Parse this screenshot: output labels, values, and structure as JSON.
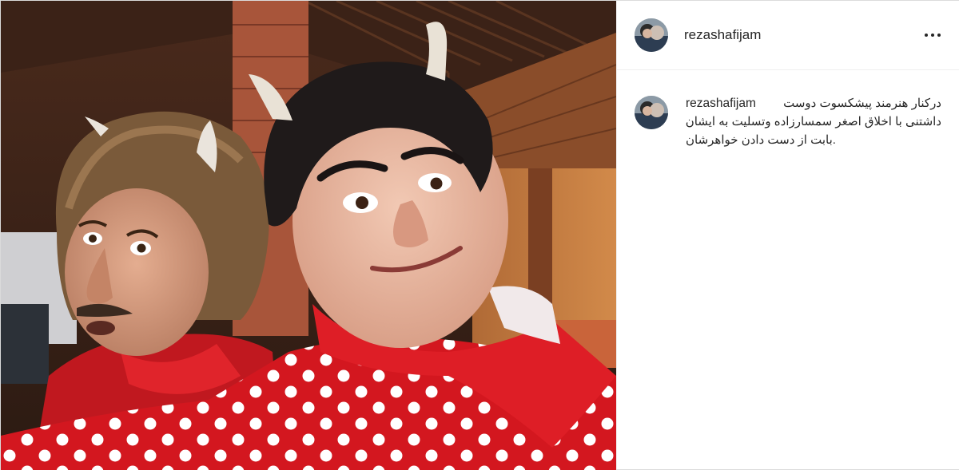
{
  "post": {
    "username": "rezashafijam",
    "more_icon": "ellipsis-icon",
    "caption": {
      "username": "rezashafijam",
      "line1": "درکنار هنرمند پیشکسوت دوست",
      "line2": "داشتنی با اخلاق اصغر سمسارزاده وتسلیت به ایشان",
      "line3": ".بابت از دست دادن خواهرشان"
    },
    "photo": {
      "description_icon": "post-photo",
      "colors": {
        "background_wood": "#5a3421",
        "shirt_red": "#d21a22",
        "dots": "#ffffff"
      }
    }
  }
}
